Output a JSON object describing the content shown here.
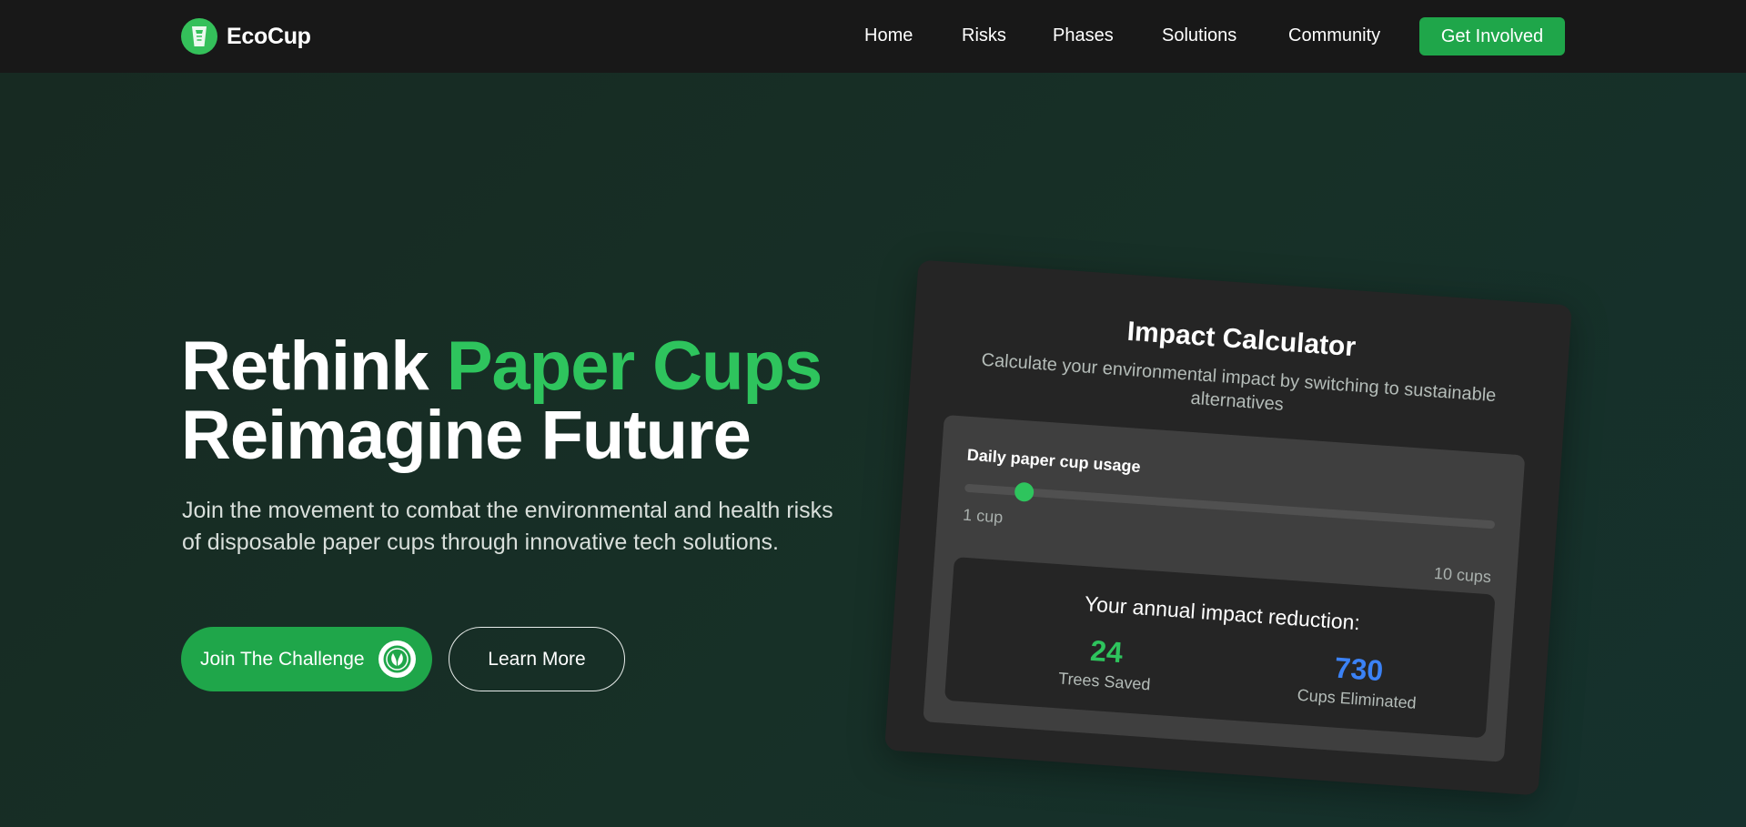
{
  "nav": {
    "brand": "EcoCup",
    "links": [
      "Home",
      "Risks",
      "Phases",
      "Solutions",
      "Community"
    ],
    "cta": "Get Involved"
  },
  "hero": {
    "headline_word1": "Rethink",
    "headline_accent": "Paper Cups",
    "headline_line2": "Reimagine Future",
    "subtext": "Join the movement to combat the environmental and health risks of disposable paper cups through innovative tech solutions.",
    "primary_button": "Join The Challenge",
    "secondary_button": "Learn More"
  },
  "calculator": {
    "title": "Impact Calculator",
    "subtitle": "Calculate your environmental impact by switching to sustainable alternatives",
    "usage_label": "Daily paper cup usage",
    "slider": {
      "min_label": "1 cup",
      "max_label": "10 cups",
      "min": 1,
      "max": 10,
      "value": 2
    },
    "impact_title": "Your annual impact reduction:",
    "trees_value": "24",
    "trees_label": "Trees Saved",
    "cups_value": "730",
    "cups_label": "Cups Eliminated"
  },
  "colors": {
    "accent_green": "#2ec45d",
    "button_green": "#1fa64a",
    "stat_blue": "#3b82f6",
    "navbar_bg": "#181818"
  },
  "icons": {
    "logo": "paper-cup-icon",
    "primary_button_badge": "leaf-globe-icon"
  }
}
